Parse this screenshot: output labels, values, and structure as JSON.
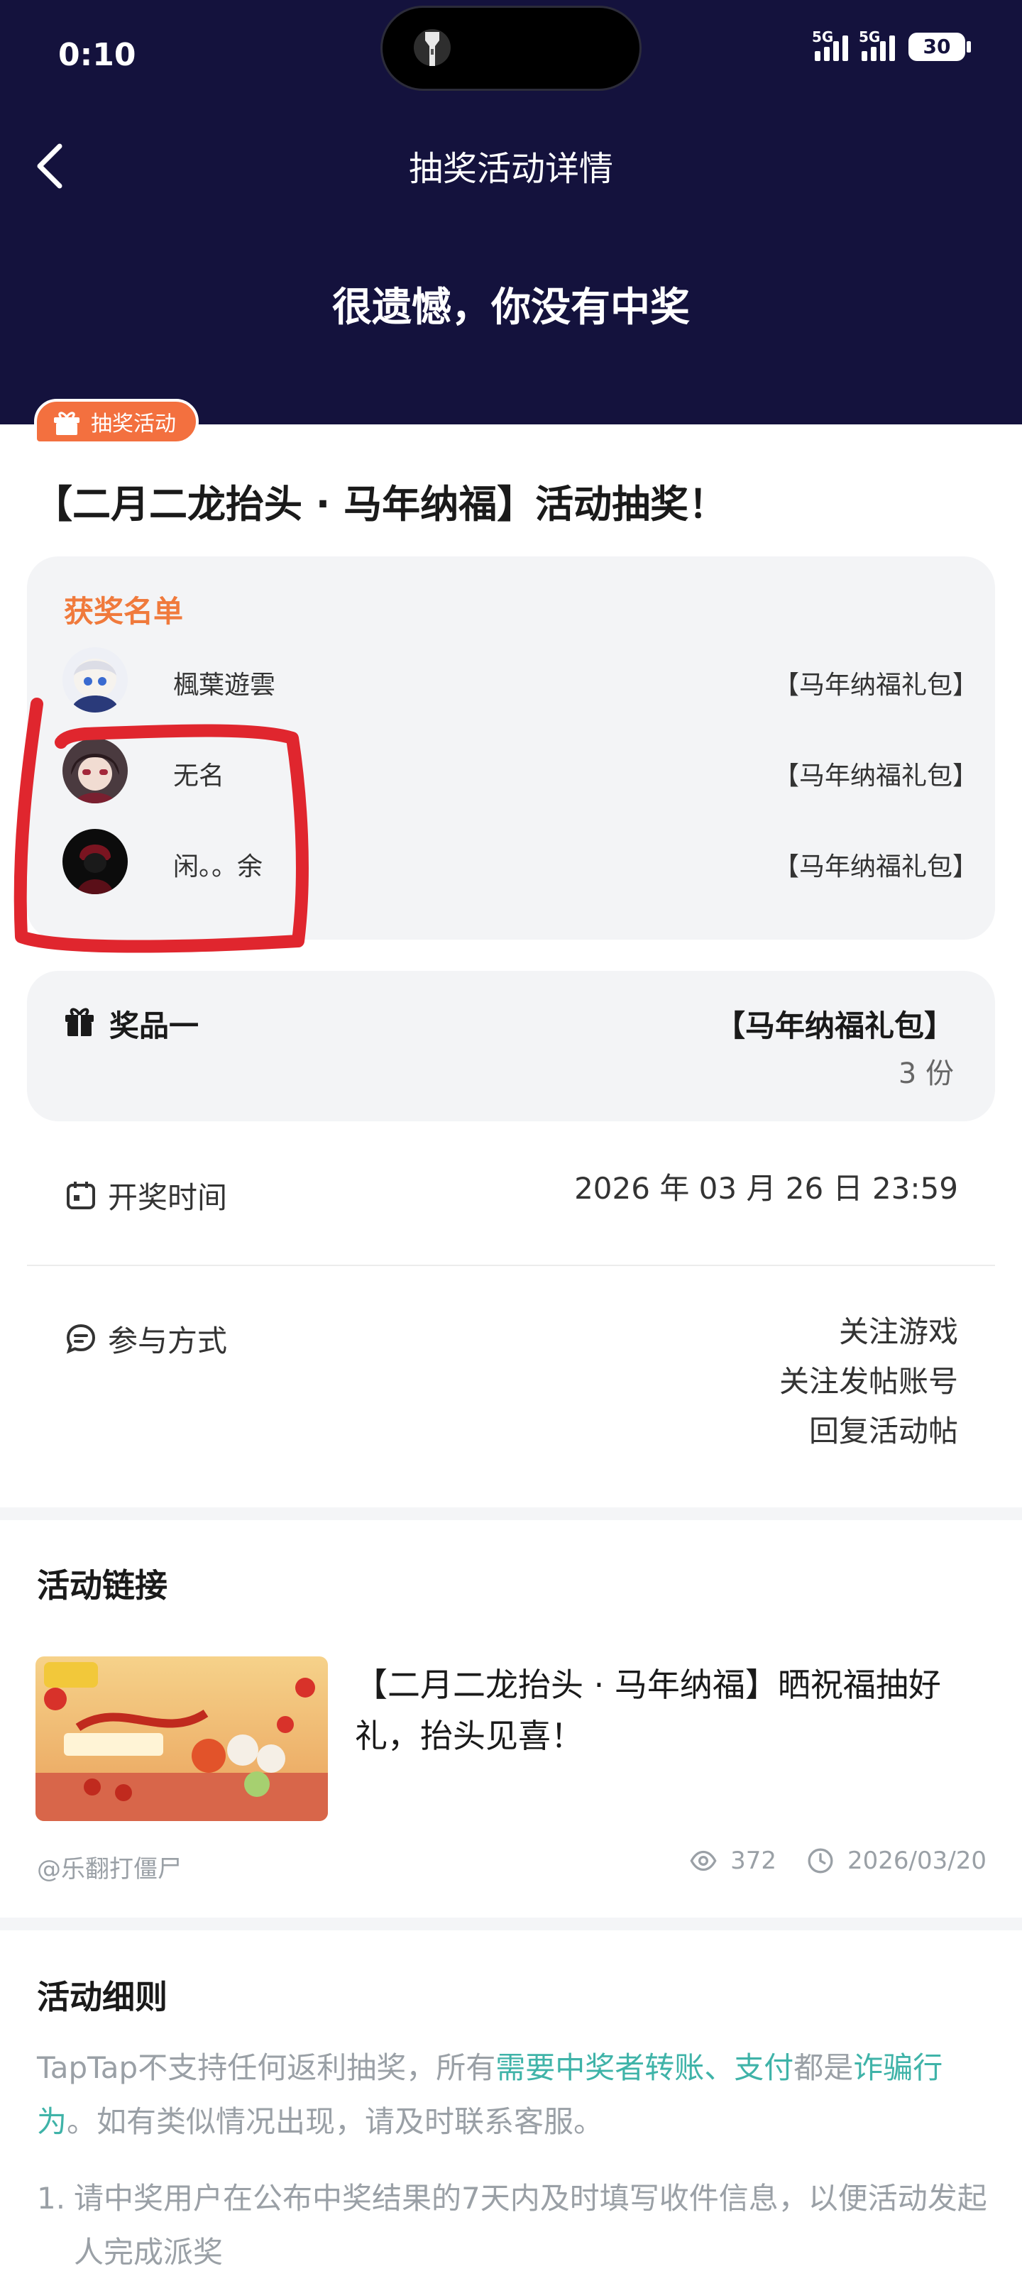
{
  "status_bar": {
    "time": "0:10",
    "network_1": "5G",
    "network_2": "5G",
    "battery": "30"
  },
  "nav": {
    "title": "抽奖活动详情"
  },
  "result": {
    "title": "很遗憾，你没有中奖"
  },
  "activity": {
    "badge": "抽奖活动",
    "title": "【二月二龙抬头 · 马年纳福】活动抽奖！"
  },
  "winners": {
    "heading": "获奖名单",
    "items": [
      {
        "name": "楓葉遊雲",
        "prize": "【马年纳福礼包】"
      },
      {
        "name": "无名",
        "prize": "【马年纳福礼包】"
      },
      {
        "name": "闲。。余",
        "prize": "【马年纳福礼包】"
      }
    ]
  },
  "prize": {
    "label": "奖品一",
    "name": "【马年纳福礼包】",
    "count": "3 份"
  },
  "draw_time": {
    "label": "开奖时间",
    "value": "2026 年 03 月 26 日 23:59"
  },
  "participation": {
    "label": "参与方式",
    "methods": [
      "关注游戏",
      "关注发帖账号",
      "回复活动帖"
    ]
  },
  "activity_link": {
    "section_title": "活动链接",
    "post_title": "【二月二龙抬头 · 马年纳福】晒祝福抽好礼，抬头见喜！",
    "author": "@乐翻打僵尸",
    "views": "372",
    "date": "2026/03/20"
  },
  "rules": {
    "section_title": "活动细则",
    "intro_1": "TapTap不支持任何返利抽奖，所有",
    "intro_hl_1": "需要中奖者转账、支付",
    "intro_2": "都是",
    "intro_hl_2": "诈骗行为",
    "intro_3": "。如有类似情况出现，请及时联系客服。",
    "item_1_num": "1.",
    "item_1": "请中奖用户在公布中奖结果的7天内及时填写收件信息，以便活动发起人完成派奖"
  },
  "colors": {
    "header_bg": "#14123d",
    "accent_orange": "#f3703f",
    "highlight_teal": "#3fb3a8",
    "card_bg": "#f3f4f6",
    "annotation_red": "#e0262e"
  }
}
